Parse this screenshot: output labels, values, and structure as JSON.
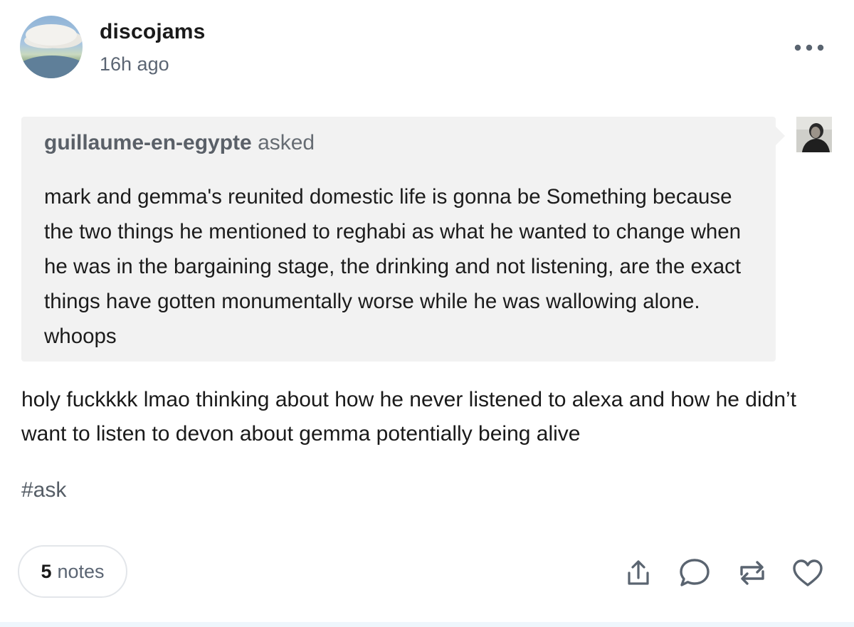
{
  "post": {
    "username": "discojams",
    "timestamp": "16h ago"
  },
  "ask": {
    "asker": "guillaume-en-egypte",
    "asked_label": "asked",
    "question": "mark and gemma's reunited domestic life is gonna be Something because the two things he mentioned to reghabi as what he wanted to change when he was in the bargaining stage, the drinking and not listening, are the exact things have gotten monumentally worse while he was wallowing alone. whoops"
  },
  "answer": {
    "text": "holy fuckkkk lmao thinking about how he never listened to alexa and how he didn’t want to listen to devon about gemma potentially being alive"
  },
  "tags": [
    "#ask"
  ],
  "footer": {
    "notes_count": "5",
    "notes_label": "notes",
    "actions": [
      "share-icon",
      "comment-icon",
      "reblog-icon",
      "like-icon"
    ]
  },
  "colors": {
    "ask_background": "#f2f2f2",
    "secondary_text": "#5b6573",
    "icon_color": "#5a6470"
  }
}
